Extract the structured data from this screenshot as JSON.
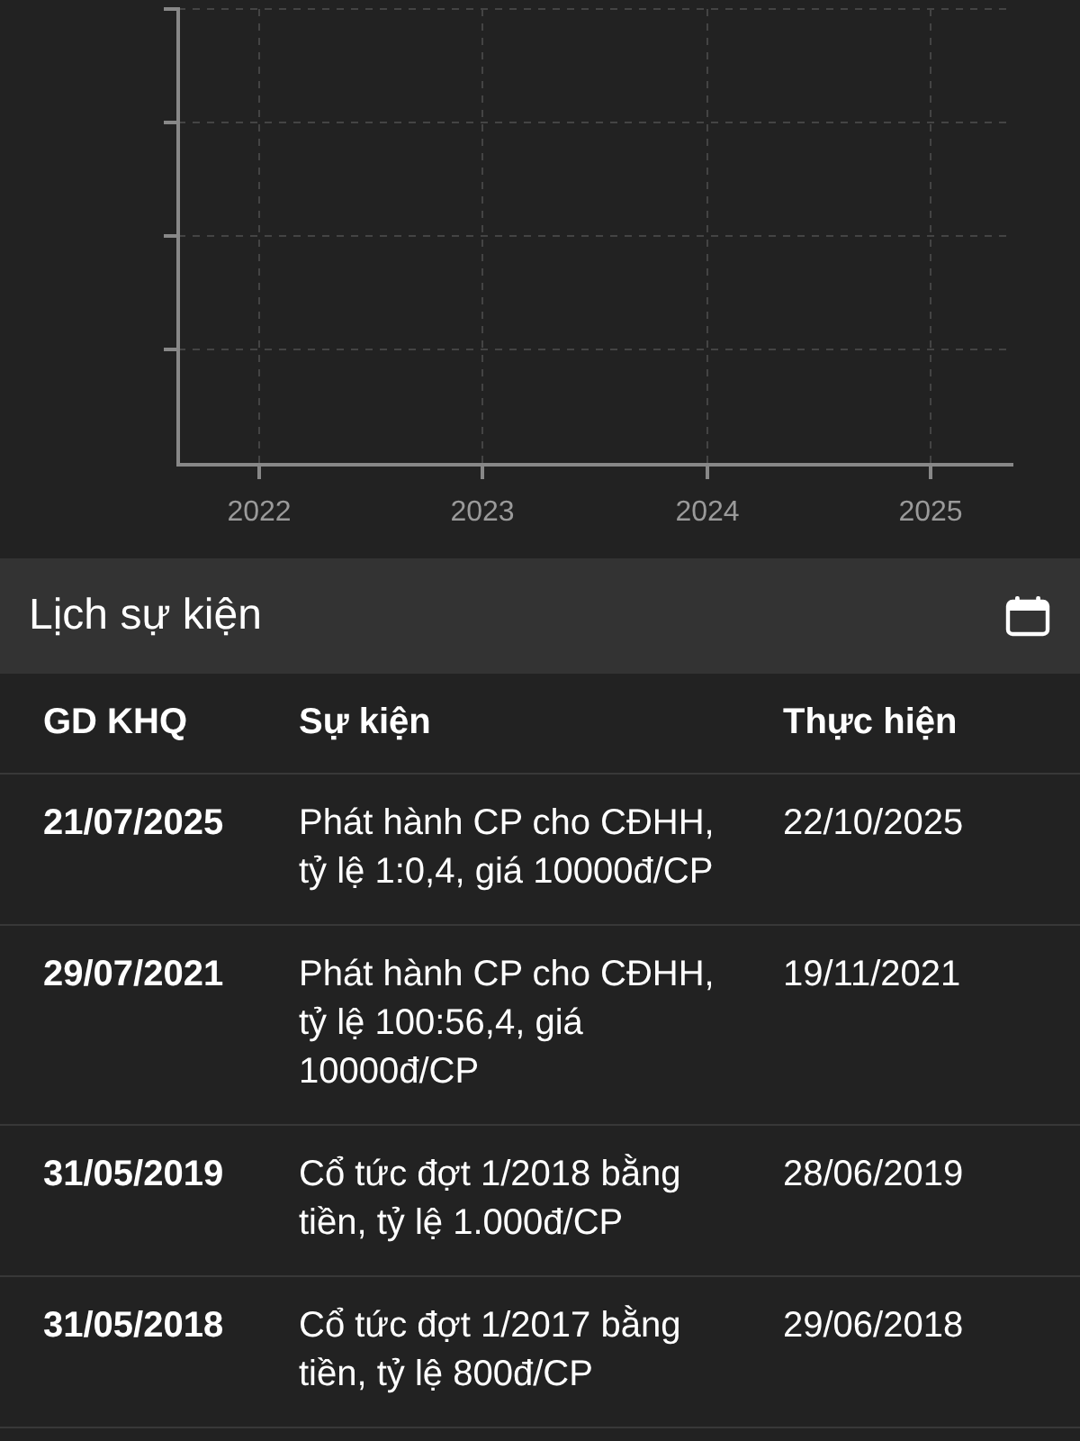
{
  "chart": {
    "x_labels": [
      "2022",
      "2023",
      "2024",
      "2025"
    ]
  },
  "events": {
    "title": "Lịch sự kiện",
    "columns": [
      "GD KHQ",
      "Sự kiện",
      "Thực hiện"
    ],
    "rows": [
      {
        "date": "21/07/2025",
        "event": "Phát hành CP cho CĐHH, tỷ lệ 1:0,4, giá 10000đ/CP",
        "done": "22/10/2025"
      },
      {
        "date": "29/07/2021",
        "event": "Phát hành CP cho CĐHH, tỷ lệ 100:56,4, giá 10000đ/CP",
        "done": "19/11/2021"
      },
      {
        "date": "31/05/2019",
        "event": "Cổ tức đợt 1/2018 bằng tiền, tỷ lệ 1.000đ/CP",
        "done": "28/06/2019"
      },
      {
        "date": "31/05/2018",
        "event": "Cổ tức đợt 1/2017 bằng tiền, tỷ lệ 800đ/CP",
        "done": "29/06/2018"
      }
    ]
  }
}
